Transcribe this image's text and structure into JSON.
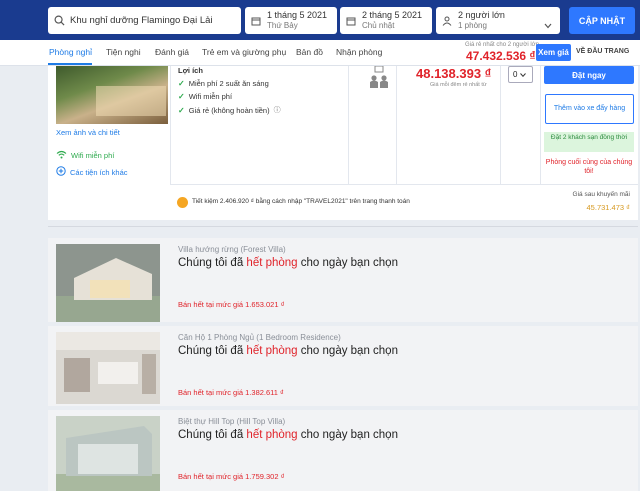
{
  "search": {
    "destination": "Khu nghỉ dưỡng Flamingo Đại Lải",
    "checkin_date": "1 tháng 5 2021",
    "checkin_day": "Thứ Bảy",
    "checkout_date": "2 tháng 5 2021",
    "checkout_day": "Chủ nhật",
    "guests": "2 người lớn",
    "rooms": "1 phòng",
    "update_label": "CẬP NHẬT"
  },
  "nav": {
    "tabs": [
      "Phòng nghỉ",
      "Tiện nghi",
      "Đánh giá",
      "Trẻ em và giường phụ",
      "Bản đồ",
      "Nhận phòng"
    ],
    "best_price_label": "Giá rẻ nhất cho 2 người lớn",
    "best_price": "47.432.536 ₫",
    "view_price_label": "Xem giá",
    "back_to_top": "VỀ ĐẦU TRANG"
  },
  "room": {
    "photo_link": "Xem ảnh và chi tiết",
    "wifi": "Wifi miễn phí",
    "amenities_link": "Các tiện ích khác",
    "benefits_title": "Lợi ích",
    "benefits": [
      "Miễn phí 2 suất ăn sáng",
      "Wifi miễn phí",
      "Giá rẻ (không hoàn tiền)"
    ],
    "price": "48.138.393 ₫",
    "price_note": "Giá mỗi đêm rẻ nhất từ",
    "quantity": "0",
    "book_label": "Đặt ngay",
    "add_cart_label": "Thêm vào xe đẩy hàng",
    "booked_note": "Đặt 2 khách sạn đồng thời",
    "last_room_note": "Phòng cuối cùng của chúng tôi!",
    "promo_text": "Tiết kiệm 2.406.920 ₫ bằng cách nhập \"TRAVEL2021\" trên trang thanh toán",
    "after_promo_label": "Giá sau khuyến mãi",
    "after_promo_price": "45.731.473 ₫"
  },
  "sold_out": {
    "msg_prefix": "Chúng tôi đã ",
    "msg_highlight": "hết phòng",
    "msg_suffix": " cho ngày bạn chọn",
    "rooms": [
      {
        "name": "Villa hướng rừng (Forest Villa)",
        "price": "Bán hết tại mức giá 1.653.021 ₫"
      },
      {
        "name": "Căn Hộ 1 Phòng Ngủ (1 Bedroom Residence)",
        "price": "Bán hết tại mức giá 1.382.611 ₫"
      },
      {
        "name": "Biệt thự Hill Top (Hill Top Villa)",
        "price": "Bán hết tại mức giá 1.759.302 ₫"
      }
    ]
  }
}
